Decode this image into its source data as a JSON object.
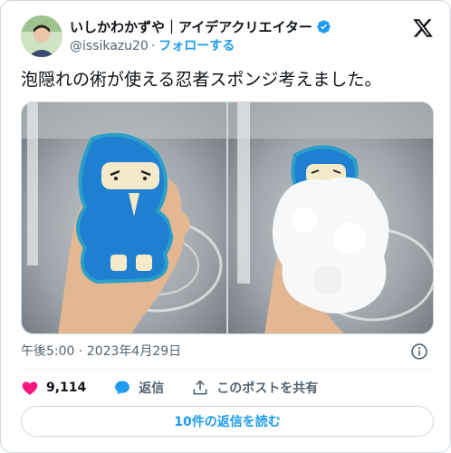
{
  "author": {
    "display_name": "いしかわかずや｜アイデアクリエイター",
    "handle": "@issikazu20",
    "separator": "·",
    "follow_label": "フォローする",
    "verified": true,
    "avatar_icon": "user-avatar"
  },
  "brand": {
    "logo_icon": "x-logo-icon"
  },
  "tweet": {
    "text": "泡隠れの術が使える忍者スポンジ考えました。"
  },
  "media": {
    "images": [
      {
        "icon": "ninja-sponge-photo"
      },
      {
        "icon": "ninja-sponge-foam-photo"
      }
    ]
  },
  "meta": {
    "timestamp": "午後5:00 · 2023年4月29日",
    "info_icon": "info-icon"
  },
  "actions": {
    "like_count": "9,114",
    "reply_label": "返信",
    "share_label": "このポストを共有"
  },
  "replies_button_label": "10件の返信を読む",
  "colors": {
    "accent": "#1d9bf0",
    "like": "#f91880",
    "text_secondary": "#536471",
    "border": "#cfd9de"
  }
}
